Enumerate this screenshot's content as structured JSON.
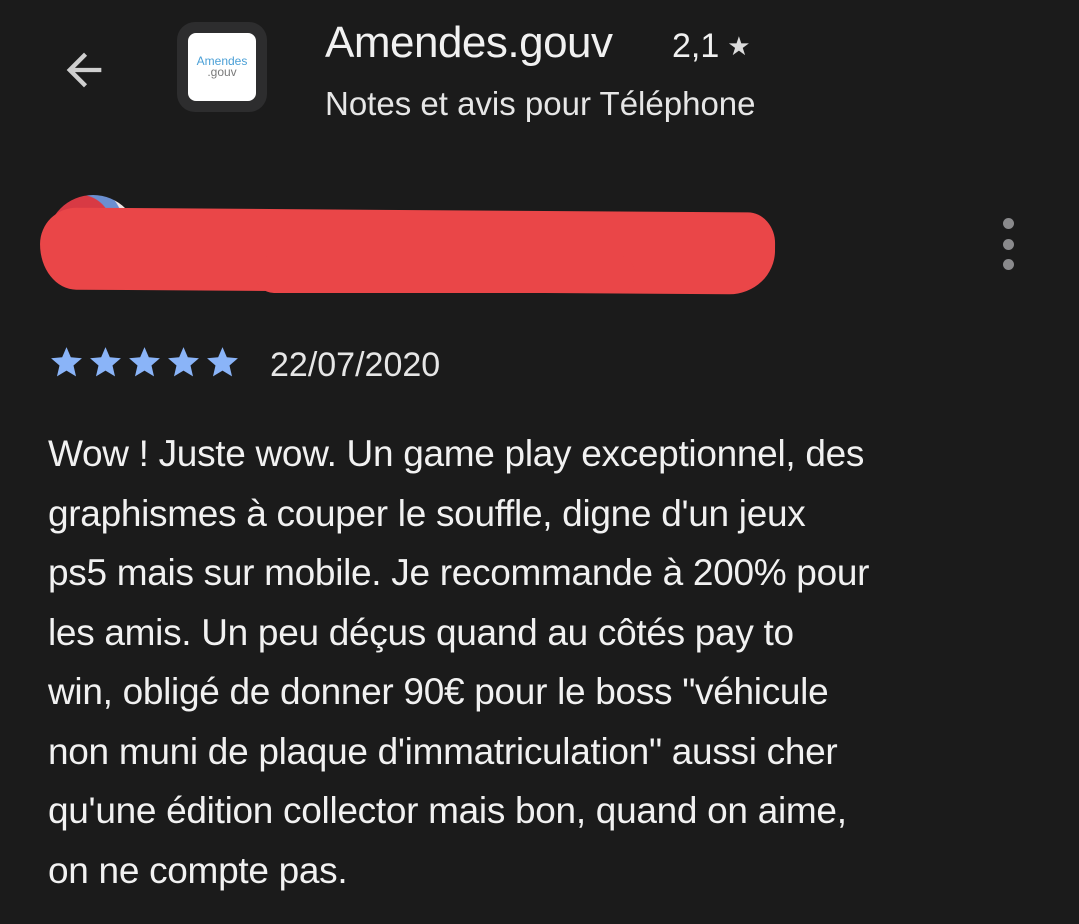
{
  "header": {
    "back_icon": "arrow-left-icon",
    "app_logo_line1": "Amendes",
    "app_logo_line2": ".gouv",
    "app_title": "Amendes.gouv",
    "rating": "2,1",
    "rating_star": "★",
    "subtitle": "Notes et avis pour Téléphone"
  },
  "review": {
    "author_redacted": true,
    "menu_icon": "more-vert-icon",
    "stars": 5,
    "star_color": "#8ab4f8",
    "date": "22/07/2020",
    "text": "Wow ! Juste wow. Un game play exceptionnel, des\ngraphismes à couper le souffle, digne d'un jeux\nps5 mais sur mobile. Je recommande à 200% pour\nles amis. Un peu déçus quand au côtés pay to\nwin, obligé de donner 90€ pour le boss \"véhicule\nnon muni de plaque d'immatriculation\" aussi cher\nqu'une édition collector mais bon, quand on aime,\non ne compte pas."
  },
  "colors": {
    "background": "#1b1b1b",
    "redaction": "#ea4648",
    "text": "#f1f1f1"
  }
}
